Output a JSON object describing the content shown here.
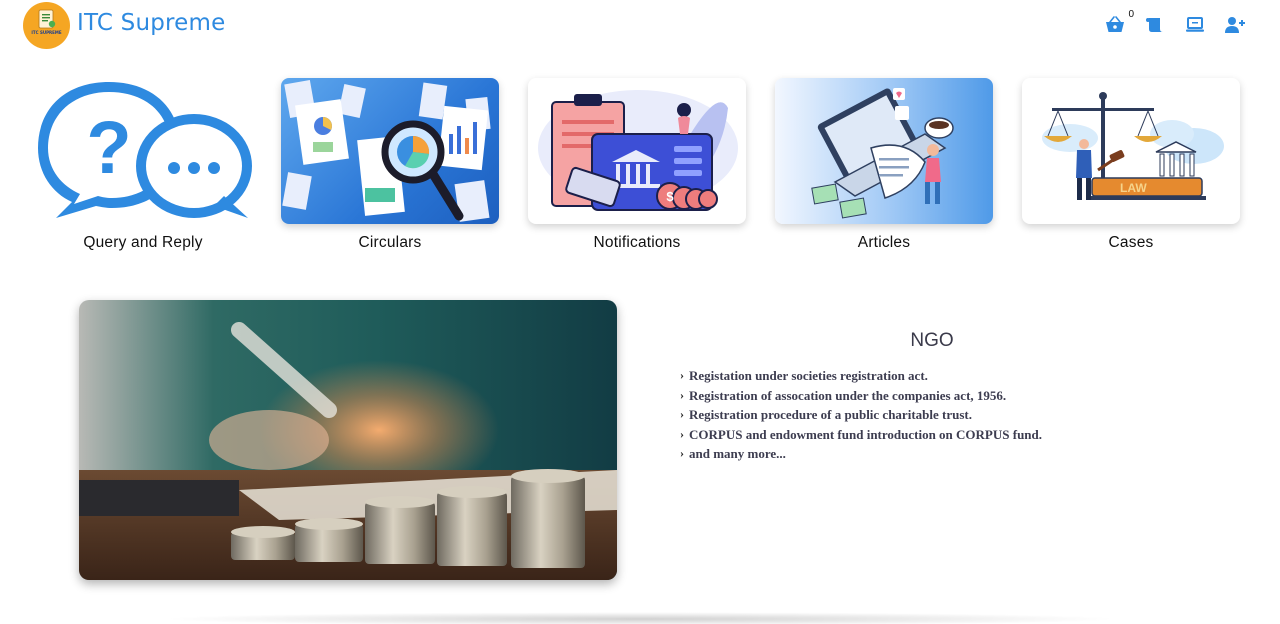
{
  "header": {
    "brand": "ITC Supreme",
    "logo_text": "ITC SUPREME",
    "cart_count": "0",
    "icons": [
      "basket-icon",
      "scroll-icon",
      "laptop-icon",
      "add-user-icon"
    ],
    "accent_color": "#2e8ae0"
  },
  "cards": [
    {
      "label": "Query and Reply",
      "icon": "query-reply-icon"
    },
    {
      "label": "Circulars",
      "icon": "circulars-image"
    },
    {
      "label": "Notifications",
      "icon": "notifications-image"
    },
    {
      "label": "Articles",
      "icon": "articles-image"
    },
    {
      "label": "Cases",
      "icon": "cases-image"
    }
  ],
  "cases_image_text": "LAW",
  "feature": {
    "title": "NGO",
    "items": [
      "Registation under societies registration act.",
      "Registration of assocation under the companies act, 1956.",
      "Registration procedure of a public charitable trust.",
      "CORPUS and endowment fund introduction on CORPUS fund.",
      "and many more..."
    ]
  }
}
